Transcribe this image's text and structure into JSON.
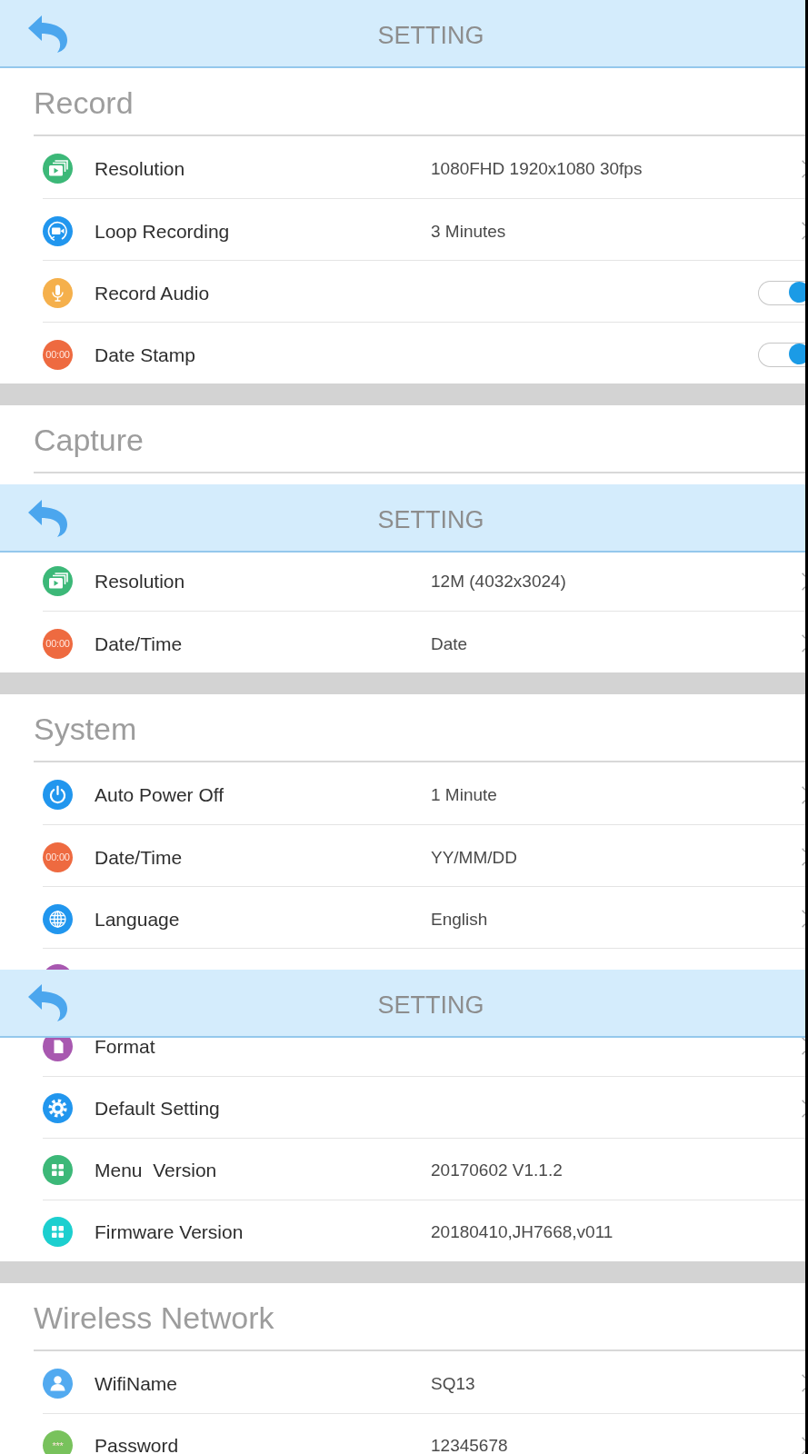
{
  "screens": [
    {
      "header": {
        "title": "SETTING"
      },
      "sections": [
        {
          "title": "Record",
          "rows": [
            {
              "color": "#3cb878",
              "label": "Resolution",
              "value": "1080FHD 1920x1080 30fps",
              "kind": "link"
            },
            {
              "color": "#2196ee",
              "label": "Loop Recording",
              "value": "3 Minutes",
              "kind": "link"
            },
            {
              "color": "#f5b04c",
              "label": "Record Audio",
              "kind": "toggle",
              "on": true
            },
            {
              "icon_text": "00:00",
              "color": "#ee6a40",
              "label": "Date Stamp",
              "kind": "toggle",
              "on": true
            }
          ]
        },
        {
          "title": "Capture"
        }
      ]
    },
    {
      "header": {
        "title": "SETTING"
      },
      "sections": [
        {
          "rows": [
            {
              "color": "#3cb878",
              "label": "Resolution",
              "value": "12M (4032x3024)",
              "kind": "link"
            },
            {
              "icon_text": "00:00",
              "color": "#ee6a40",
              "label": "Date/Time",
              "value": "Date",
              "kind": "link"
            }
          ]
        },
        {
          "title": "System",
          "rows": [
            {
              "color": "#2196ee",
              "label": "Auto Power Off",
              "value": "1 Minute",
              "kind": "link"
            },
            {
              "icon_text": "00:00",
              "color": "#ee6a40",
              "label": "Date/Time",
              "value": "YY/MM/DD",
              "kind": "link"
            },
            {
              "color": "#2196ee",
              "label": "Language",
              "value": "English",
              "kind": "link"
            },
            {
              "color": "#a858b0"
            }
          ]
        }
      ]
    },
    {
      "header": {
        "title": "SETTING"
      },
      "sections": [
        {
          "rows": [
            {
              "color": "#a858b0",
              "label": "Format",
              "kind": "link"
            },
            {
              "color": "#2196ee",
              "label": "Default Setting",
              "kind": "link"
            },
            {
              "color": "#3cb878",
              "label": "Menu  Version",
              "value": "20170602 V1.1.2",
              "kind": "info"
            },
            {
              "color": "#1ccfcf",
              "label": "Firmware Version",
              "value": "20180410,JH7668,v011",
              "kind": "info"
            }
          ]
        },
        {
          "title": "Wireless Network",
          "rows": [
            {
              "color": "#52aaf0",
              "label": "WifiName",
              "value": "SQ13",
              "kind": "link"
            },
            {
              "icon_text": "***",
              "color": "#78c25c",
              "label": "Password",
              "value": "12345678",
              "kind": "link"
            }
          ]
        }
      ]
    }
  ]
}
